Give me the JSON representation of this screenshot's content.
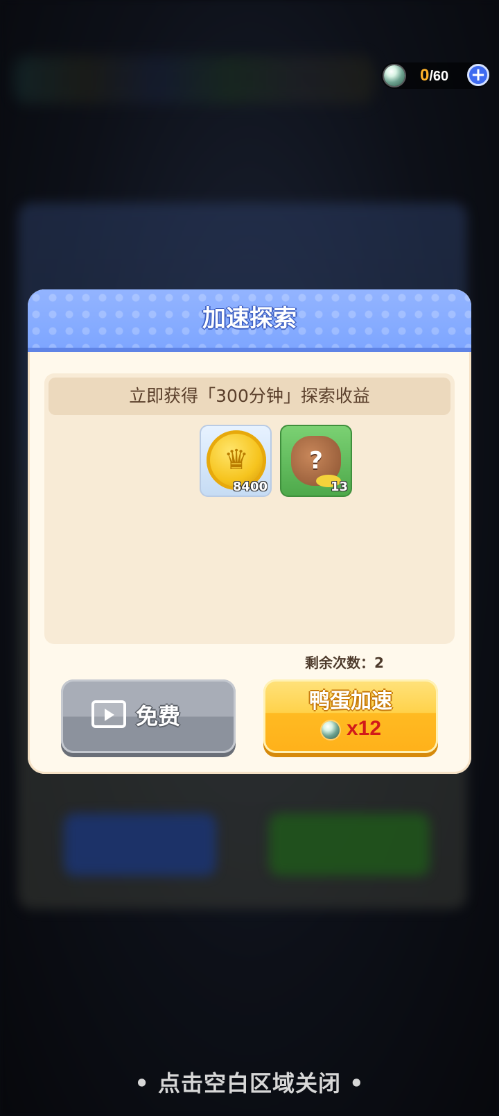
{
  "currency": {
    "current": "0",
    "max_text": "/60"
  },
  "dialog": {
    "title": "加速探索",
    "reward_banner": "立即获得「300分钟」探索收益",
    "rewards": [
      {
        "icon": "gold-coin-icon",
        "count": "8400"
      },
      {
        "icon": "mystery-bag-icon",
        "count": "13"
      }
    ],
    "remaining_label": "剩余次数：2",
    "free_button_label": "免费",
    "egg_button_label": "鸭蛋加速",
    "egg_button_cost": "x12"
  },
  "close_hint": "• 点击空白区域关闭 •",
  "colors": {
    "header_blue": "#7ea6ff",
    "dialog_bg": "#fff9ec",
    "accent_yellow": "#ffb11a",
    "cost_red": "#d11a1a"
  }
}
